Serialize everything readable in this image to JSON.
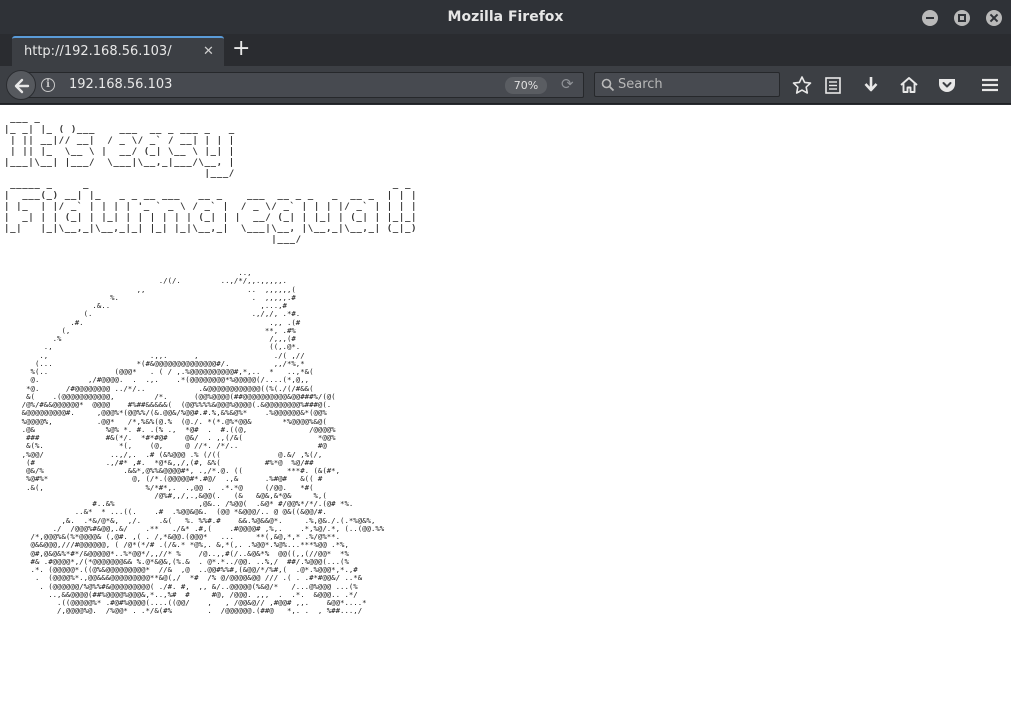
{
  "window": {
    "title": "Mozilla Firefox"
  },
  "tab": {
    "label": "http://192.168.56.103/"
  },
  "navbar": {
    "url": "192.168.56.103",
    "zoom": "70%",
    "search_placeholder": "Search"
  },
  "colors": {
    "chrome": "#2f3237",
    "toolbar": "#3c3f44",
    "tab_accent": "#5a9bd8",
    "page_bg": "#ffffff"
  },
  "icons": [
    "minimize-icon",
    "maximize-icon",
    "close-icon",
    "tab-close-icon",
    "new-tab-icon",
    "back-arrow-icon",
    "info-icon",
    "reload-icon",
    "search-icon",
    "bookmark-star-icon",
    "reading-list-icon",
    "download-icon",
    "home-icon",
    "pocket-icon",
    "hamburger-menu-icon"
  ],
  "page": {
    "banner": " ___ _    \n|_ _| |_ ( )___    ___  __ _ ___ _   _ \n | || __|// __|  / _ \\/ _` / __| | | |\n | || |_  \\__ \\ |  __/ (_| \\__ \\ |_| |\n|___|\\__| |___/  \\___|\\__,_|___/\\__, |\n                                 |___/ \n _____ _     _                                                  _ _\n|  ___(_) __| |_   _ _ __ ___   __ _    ___  __ _ _   _  __ _  | | |\n| |_  | |/ _` | | | | '_ ` _ \\ / _` |  / _ \\/ _` | | | |/ _` | | | |\n|  _| | | (_| | |_| | | | | | | (_| | |  __/ (_| | |_| | (_| | |_|_|\n|_|   |_|\\__,_|\\__,_|_| |_| |_|\\__,_|  \\___|\\__, |\\__,_|\\__,_| (_|_)\n                                            |___/",
    "ascii_art": "                                                     ..,\n                                   ./(/.         ..,/*/,,.,,,,,.\n                              ,,                       ..  ,,,,,,(\n                        %.                              .  ,,,,,.#\n                    .&..                                  ,...,#\n                  (.                                    .,/,/, .*#.\n               .#.                                          .,, .(#\n             (,                                            **, .#%\n           .%                                               /,,,(#\n         .,                                                 ((,.@*.\n        .,                       .,,.      ,                 ./( ,//\n       (...                   *(#&@@@@@@@@@@@@@@#/.          ,,/*%,*\n      %(..               (@@@*   . ( / ,.%@@@@@@@@@@#,*,..  *   ..,*&(\n      @.           ,/#@@@@.  .  .,.    .*(@@@@@@@@*%@@@@@(/....(*,@,,\n     *@.      /#@@@@@@@@ ../*/..            .&@@@@@@@@@@@@((%(./(/#&&(\n     &(    .(@@@@@@@@@@@,         /*.      (@@%@@@@(##@@@@@@@@@@&@@###%/(@(\n    /@%/#&&@@@@@@*  @@@@    #%##&&&&&(  (@@%%%%&@@@%@@@@(.&@@@@@@@@%###@(.\n    &@@@@@@@@@#.     ,@@@%*(@@%%/(&.@@&/%@@#.#.%,&%&@%*    .%@@@@@@&*(@@%\n    %@@@@%,          .@@*   /*,%&%(@.%  (@./. *(*.@%*@@&       *%@@@@%&@(\n    .@&                %@% *. #. .(% .,  *@#  .  #.((@,              /@@@@%\n     ###               #&(*/.  *#*#@#    @&/  . ,,(/&(                 *@@%\n     &(%.                 *(,    (@,     @ //*. /*/..                  #@\n    ,%@@/               ..,/,.  .# (&%@@@ .% (/((             @.&/ ,%(/,\n     (#                .,/#* ,#.  *@*&,,/,(#, &%(          #%*@  %@/##\n     @&/%                  .&&*,@%%&@@@@#*, .,/*.@. ((          ***#. (&(#*,\n     %@#%*                   @, (/*.(@@@@@#*.#@/  .,&      .%#@#   &(( #\n     .&(,                       %/*#*,.  .,@@ .  .*.*@     (/@@.   *#(\n                                  /@%#,,/,.,&@@(.   (&   &@&,&*@&     %,(\n                    #..&%                   ,@&.. /%@@(  .&@* #/@@%*/*/.(@# *%.\n                ..&*  * ...((.    .#  .%@@&@&.  (@@ *&@@@/.. @ @&((&@@/#.\n             ,&.  .*&/@*&,  ,/.    .&(   %. %%#.#    &&.%@&&@*.     .%,@&./.(.*%@&%,\n           ./  /@@@%#&@@,.&/    .**   ./&* .#,(    .#@@@@# ,%,.    .*,%@/.*, (..(@@.%%\n      /*,@@@%&(%*@@@@& (,@#. ,( . /,*&@@.(@@@*   ...     **(,&@,*,* .%/@%**.\n      @&&@@@,///#@@@@@@, ( /@*(*/# .(/&.* *@%,. &,*(,. .%@@*.%@%...***%@@ .*%,\n      @#,@&@&%*#*/&@@@@@*..%*@@*/,,//* %    /@..,,#(/..&@&*%  @@((,,(//@@*  *%\n      #& .#@@@@*,/(*@@@@@@@&& %.@*&@&,(%.&  . @*.*../@@. ..%,/  ##/.%@@@(...(%\n      .*. (@@@@@*.((@%&@@@@@@@@@*  //&  ,@  ..@@#%%#,(&@@/*/%#,(  .@*.%@@@*,*.,#\n       .  (@@@@%*.,@@&&&@@@@@@@@@**&@(,/  *#  /% @/@@@@&@@ /// .( . .#*#@@&/ ..*&\n        . (@@@@@@/%@%%#&@@@@@@@@@( ./#. #,  ,, &/..@@@@@(%&@/*   /...@%@@@ ...(%\n          ..,&&@@@@(##%@@@@%@@@&,*..,%#  #     #@, /@@@. ,,,  .  .*.  &@@@.. .*/\n            .((@@@@@%* .#@#%@@@@(....((@@/    ,   , /@@&@// ,#@@# ,,.    &@@*....*\n            /,@@@@%@.  /%@@* . .*/&(#%        .  /@@@@@@.(##@   *,. .  , %##...,/"
  }
}
